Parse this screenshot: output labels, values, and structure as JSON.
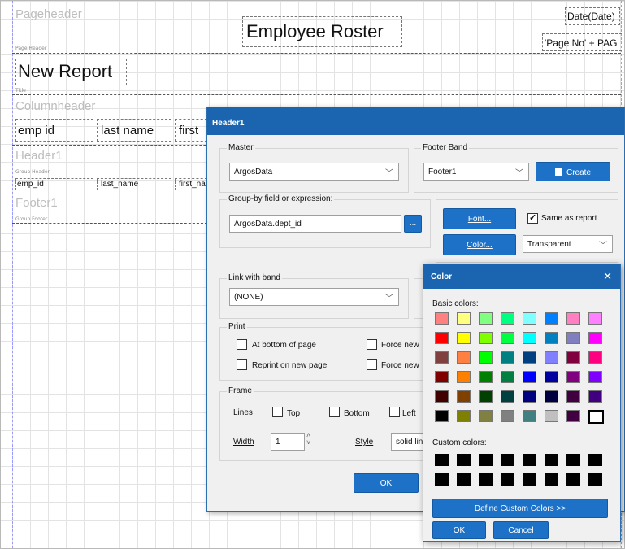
{
  "report": {
    "page_header_band": "Pageheader",
    "page_header_label": "Page Header",
    "report_title": "Employee Roster",
    "date_field": "Date(Date)",
    "page_no_field": "'Page No' + PAG",
    "title_text": "New Report",
    "title_label": "Title",
    "column_header_band": "Columnheader",
    "col_emp_id": "emp id",
    "col_last_name": "last name",
    "col_first": "first",
    "header1_band": "Header1",
    "group_header_label": "Group Header",
    "field_emp_id": "emp_id",
    "field_last_name": "last_name",
    "field_first_name": "first_na",
    "footer1_band": "Footer1",
    "group_footer_label": "Group Footer"
  },
  "header_dialog": {
    "title": "Header1",
    "master_label": "Master",
    "master_value": "ArgosData",
    "footer_band_label": "Footer Band",
    "footer_band_value": "Footer1",
    "create_button": "Create",
    "groupby_label": "Group-by field or expression:",
    "groupby_value": "ArgosData.dept_id",
    "ellipsis_button": "...",
    "font_button": "Font...",
    "same_as_report_label": "Same as report",
    "same_as_report_checked": true,
    "color_button": "Color...",
    "color_value": "Transparent",
    "link_label": "Link with band",
    "link_value": "(NONE)",
    "print_label": "Print",
    "at_bottom_label": "At bottom of page",
    "force_new_1_label": "Force new",
    "reprint_label": "Reprint on new page",
    "force_new_2_label": "Force new",
    "frame_label": "Frame",
    "lines_label": "Lines",
    "top_label": "Top",
    "bottom_label": "Bottom",
    "left_label": "Left",
    "width_label": "Width",
    "width_value": "1",
    "style_label": "Style",
    "style_value": "solid lin",
    "ok_button": "OK"
  },
  "color_dialog": {
    "title": "Color",
    "basic_colors_label": "Basic colors:",
    "basic_colors": [
      [
        "#ff8080",
        "#ffff80",
        "#80ff80",
        "#00ff80",
        "#80ffff",
        "#0080ff",
        "#ff80c0",
        "#ff80ff"
      ],
      [
        "#ff0000",
        "#ffff00",
        "#80ff00",
        "#00ff40",
        "#00ffff",
        "#0080c0",
        "#8080c0",
        "#ff00ff"
      ],
      [
        "#804040",
        "#ff8040",
        "#00ff00",
        "#008080",
        "#004080",
        "#8080ff",
        "#800040",
        "#ff0080"
      ],
      [
        "#800000",
        "#ff8000",
        "#008000",
        "#008040",
        "#0000ff",
        "#0000a0",
        "#800080",
        "#8000ff"
      ],
      [
        "#400000",
        "#804000",
        "#004000",
        "#004040",
        "#000080",
        "#000040",
        "#400040",
        "#400080"
      ],
      [
        "#000000",
        "#808000",
        "#808040",
        "#808080",
        "#408080",
        "#c0c0c0",
        "#400040",
        "#ffffff"
      ]
    ],
    "custom_colors_label": "Custom colors:",
    "define_button": "Define Custom Colors >>",
    "ok_button": "OK",
    "cancel_button": "Cancel"
  },
  "icons": {
    "create": "document-icon",
    "close": "close-icon",
    "dropdown": "chevron-down-icon"
  }
}
